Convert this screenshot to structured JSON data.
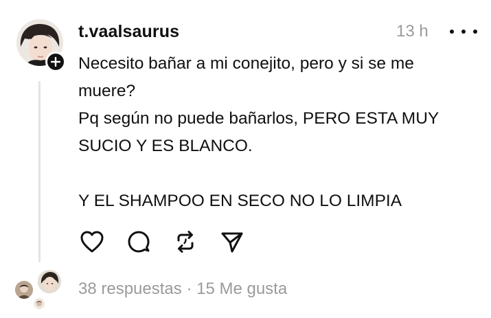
{
  "post": {
    "username": "t.vaalsaurus",
    "timestamp": "13 h",
    "body_lines": [
      "Necesito bañar a mi conejito, pero y si se me",
      "muere?",
      "Pq según no puede bañarlos, PERO ESTA MUY",
      "SUCIO Y ES BLANCO.",
      "Y EL SHAMPOO EN SECO NO LO LIMPIA"
    ]
  },
  "actions": {
    "like": "heart-icon",
    "reply": "comment-icon",
    "repost": "repost-icon",
    "share": "send-icon"
  },
  "stats": {
    "replies": "38 respuestas",
    "separator": "·",
    "likes": "15 Me gusta"
  },
  "colors": {
    "text": "#101010",
    "muted": "#9a9a9a",
    "thread_line": "#e3e3e3",
    "background": "#ffffff"
  }
}
